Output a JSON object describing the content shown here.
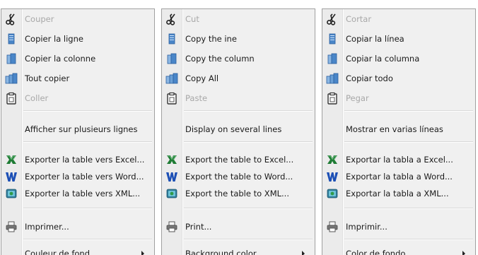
{
  "menus": [
    {
      "cut": "Couper",
      "copy_line": "Copier la ligne",
      "copy_column": "Copier la colonne",
      "copy_all": "Tout copier",
      "paste": "Coller",
      "multi_line": "Afficher sur plusieurs lignes",
      "export_excel": "Exporter la table vers Excel...",
      "export_word": "Exporter la table vers Word...",
      "export_xml": "Exporter la table vers XML...",
      "print": "Imprimer...",
      "bg_color": "Couleur de fond"
    },
    {
      "cut": "Cut",
      "copy_line": "Copy the ine",
      "copy_column": "Copy the column",
      "copy_all": "Copy All",
      "paste": "Paste",
      "multi_line": "Display on several lines",
      "export_excel": "Export the table to Excel...",
      "export_word": "Export the table to Word...",
      "export_xml": "Export the table to XML...",
      "print": "Print...",
      "bg_color": "Background color"
    },
    {
      "cut": "Cortar",
      "copy_line": "Copiar la línea",
      "copy_column": "Copiar la columna",
      "copy_all": "Copiar todo",
      "paste": "Pegar",
      "multi_line": "Mostrar en varias líneas",
      "export_excel": "Exportar la tabla a Excel...",
      "export_word": "Exportar la tabla a Word...",
      "export_xml": "Exportar la tabla a XML...",
      "print": "Imprimir...",
      "bg_color": "Color de fondo"
    }
  ],
  "icons": {
    "cut": "scissors-icon",
    "copy_line": "copy-line-icon",
    "copy_column": "copy-column-icon",
    "copy_all": "copy-all-icon",
    "paste": "clipboard-icon",
    "export_excel": "excel-icon",
    "export_word": "word-icon",
    "export_xml": "xml-icon",
    "print": "printer-icon",
    "bg_color": "submenu-arrow-icon"
  },
  "colors": {
    "menu_bg": "#f0f0f0",
    "disabled_text": "#a8a8a8",
    "excel_green": "#1e7b34",
    "word_blue": "#1c4fb5",
    "copy_blue": "#4a86c8"
  }
}
